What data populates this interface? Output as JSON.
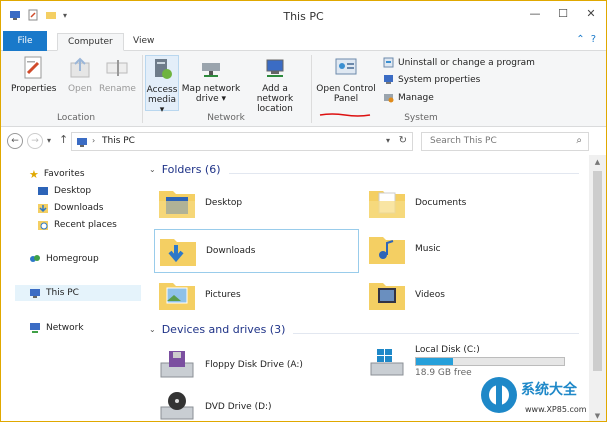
{
  "window": {
    "title": "This PC"
  },
  "title_buttons": [
    "—",
    "☐",
    "✕"
  ],
  "tabs": {
    "file": "File",
    "computer": "Computer",
    "view": "View"
  },
  "ribbon": {
    "location": {
      "label": "Location",
      "properties": "Properties",
      "open": "Open",
      "rename": "Rename"
    },
    "network": {
      "label": "Network",
      "access_media_1": "Access",
      "access_media_2": "media",
      "map_drive_1": "Map network",
      "map_drive_2": "drive",
      "add_location_1": "Add a network",
      "add_location_2": "location"
    },
    "system": {
      "label": "System",
      "control_panel_1": "Open Control",
      "control_panel_2": "Panel",
      "uninstall": "Uninstall or change a program",
      "sys_props": "System properties",
      "manage": "Manage"
    }
  },
  "address": {
    "path": "This PC",
    "search_placeholder": "Search This PC"
  },
  "nav": {
    "favorites": "Favorites",
    "desktop": "Desktop",
    "downloads": "Downloads",
    "recent": "Recent places",
    "homegroup": "Homegroup",
    "this_pc": "This PC",
    "network": "Network"
  },
  "content": {
    "folders_header": "Folders (6)",
    "folders": [
      "Desktop",
      "Documents",
      "Downloads",
      "Music",
      "Pictures",
      "Videos"
    ],
    "devices_header": "Devices and drives (3)",
    "floppy": "Floppy Disk Drive (A:)",
    "local_disk": "Local Disk (C:)",
    "local_disk_free": "18.9 GB free",
    "local_disk_used_fraction": 0.25,
    "dvd": "DVD Drive (D:)"
  },
  "watermark": {
    "name": "系统大全",
    "url": "www.XP85.com"
  },
  "colors": {
    "accent": "#1979ca",
    "frame": "#e0a800",
    "section_text": "#1e3287",
    "drive_fill": "#26a0da",
    "selection": "#99cceb"
  }
}
